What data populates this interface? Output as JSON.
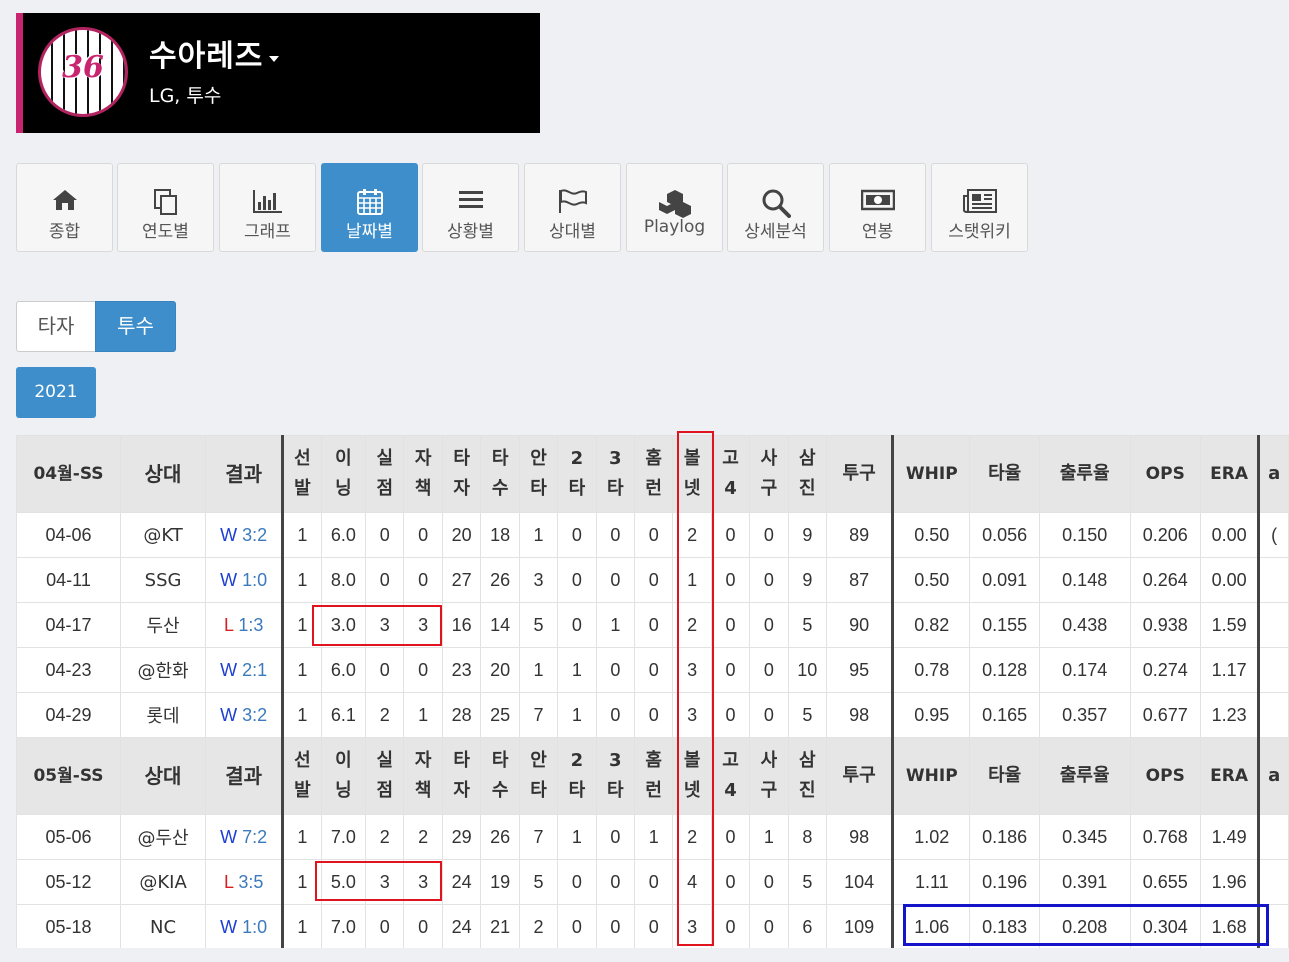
{
  "player": {
    "number": "36",
    "name": "수아레즈",
    "sub": "LG, 투수"
  },
  "nav": [
    {
      "label": "종합",
      "icon": "home-icon"
    },
    {
      "label": "연도별",
      "icon": "copy-icon"
    },
    {
      "label": "그래프",
      "icon": "bar-chart-icon"
    },
    {
      "label": "날짜별",
      "icon": "calendar-icon",
      "active": true
    },
    {
      "label": "상황별",
      "icon": "list-icon"
    },
    {
      "label": "상대별",
      "icon": "flag-icon"
    },
    {
      "label": "Playlog",
      "icon": "cubes-icon"
    },
    {
      "label": "상세분석",
      "icon": "search-icon"
    },
    {
      "label": "연봉",
      "icon": "money-icon"
    },
    {
      "label": "스탯위키",
      "icon": "newspaper-icon"
    }
  ],
  "toggle": {
    "batter": "타자",
    "pitcher": "투수"
  },
  "year": "2021",
  "headers": {
    "opp": "상대",
    "result": "결과",
    "cols": [
      "선\n발",
      "이\n닝",
      "실\n점",
      "자\n책",
      "타\n자",
      "타\n수",
      "안\n타",
      "2\n타",
      "3\n타",
      "홈\n런",
      "볼\n넷",
      "고\n4",
      "사\n구",
      "삼\n진"
    ],
    "pitches": "투구",
    "rates": [
      "WHIP",
      "타율",
      "출루율",
      "OPS",
      "ERA"
    ],
    "cut": "a"
  },
  "sections": [
    {
      "label": "04월-SS",
      "rows": [
        {
          "date": "04-06",
          "opp": "@KT",
          "res": "W",
          "score": "3:2",
          "v": [
            "1",
            "6.0",
            "0",
            "0",
            "20",
            "18",
            "1",
            "0",
            "0",
            "0",
            "2",
            "0",
            "0",
            "9",
            "89"
          ],
          "r": [
            "0.50",
            "0.056",
            "0.150",
            "0.206",
            "0.00"
          ],
          "cut": "("
        },
        {
          "date": "04-11",
          "opp": "SSG",
          "res": "W",
          "score": "1:0",
          "v": [
            "1",
            "8.0",
            "0",
            "0",
            "27",
            "26",
            "3",
            "0",
            "0",
            "0",
            "1",
            "0",
            "0",
            "9",
            "87"
          ],
          "r": [
            "0.50",
            "0.091",
            "0.148",
            "0.264",
            "0.00"
          ],
          "cut": ""
        },
        {
          "date": "04-17",
          "opp": "두산",
          "res": "L",
          "score": "1:3",
          "v": [
            "1",
            "3.0",
            "3",
            "3",
            "16",
            "14",
            "5",
            "0",
            "1",
            "0",
            "2",
            "0",
            "0",
            "5",
            "90"
          ],
          "r": [
            "0.82",
            "0.155",
            "0.438",
            "0.938",
            "1.59"
          ],
          "cut": ""
        },
        {
          "date": "04-23",
          "opp": "@한화",
          "res": "W",
          "score": "2:1",
          "v": [
            "1",
            "6.0",
            "0",
            "0",
            "23",
            "20",
            "1",
            "1",
            "0",
            "0",
            "3",
            "0",
            "0",
            "10",
            "95"
          ],
          "r": [
            "0.78",
            "0.128",
            "0.174",
            "0.274",
            "1.17"
          ],
          "cut": ""
        },
        {
          "date": "04-29",
          "opp": "롯데",
          "res": "W",
          "score": "3:2",
          "v": [
            "1",
            "6.1",
            "2",
            "1",
            "28",
            "25",
            "7",
            "1",
            "0",
            "0",
            "3",
            "0",
            "0",
            "5",
            "98"
          ],
          "r": [
            "0.95",
            "0.165",
            "0.357",
            "0.677",
            "1.23"
          ],
          "cut": ""
        }
      ]
    },
    {
      "label": "05월-SS",
      "rows": [
        {
          "date": "05-06",
          "opp": "@두산",
          "res": "W",
          "score": "7:2",
          "v": [
            "1",
            "7.0",
            "2",
            "2",
            "29",
            "26",
            "7",
            "1",
            "0",
            "1",
            "2",
            "0",
            "1",
            "8",
            "98"
          ],
          "r": [
            "1.02",
            "0.186",
            "0.345",
            "0.768",
            "1.49"
          ],
          "cut": ""
        },
        {
          "date": "05-12",
          "opp": "@KIA",
          "res": "L",
          "score": "3:5",
          "v": [
            "1",
            "5.0",
            "3",
            "3",
            "24",
            "19",
            "5",
            "0",
            "0",
            "0",
            "4",
            "0",
            "0",
            "5",
            "104"
          ],
          "r": [
            "1.11",
            "0.196",
            "0.391",
            "0.655",
            "1.96"
          ],
          "cut": ""
        },
        {
          "date": "05-18",
          "opp": "NC",
          "res": "W",
          "score": "1:0",
          "v": [
            "1",
            "7.0",
            "0",
            "0",
            "24",
            "21",
            "2",
            "0",
            "0",
            "0",
            "3",
            "0",
            "0",
            "6",
            "109"
          ],
          "r": [
            "1.06",
            "0.183",
            "0.208",
            "0.304",
            "1.68"
          ],
          "cut": ""
        }
      ]
    }
  ]
}
